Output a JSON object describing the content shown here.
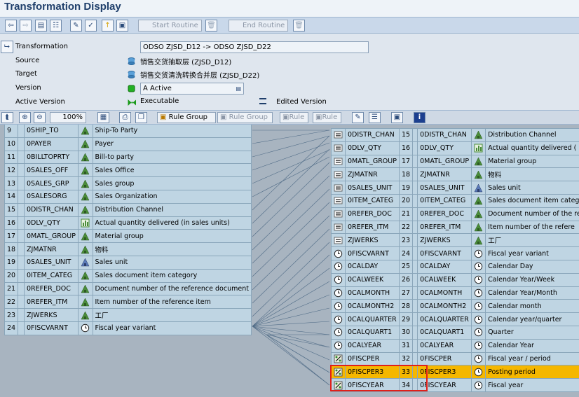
{
  "title": "Transformation Display",
  "app_toolbar": {
    "start_routine": "Start Routine",
    "end_routine": "End Routine"
  },
  "header": {
    "transformation_label": "Transformation",
    "transformation_value": "ODSO ZJSD_D12 -> ODSO ZJSD_D22",
    "source_label": "Source",
    "source_value": "销售交货抽取层 (ZJSD_D12)",
    "target_label": "Target",
    "target_value": "销售交货清洗转换合并层 (ZJSD_D22)",
    "version_label": "Version",
    "version_value": "A Active",
    "active_version_label": "Active Version",
    "active_version_value": "Executable",
    "edited_version_label": "Edited Version"
  },
  "canvas_toolbar": {
    "zoom": "100%",
    "rule_group": "Rule Group",
    "rule_group_disabled": "Rule Group",
    "rule": "Rule",
    "rule_disabled": "Rule"
  },
  "source_rows": [
    {
      "num": "9",
      "name": "0SHIP_TO",
      "icon": "characteristic-icon",
      "desc": "Ship-To Party"
    },
    {
      "num": "10",
      "name": "0PAYER",
      "icon": "characteristic-icon",
      "desc": "Payer"
    },
    {
      "num": "11",
      "name": "0BILLTOPRTY",
      "icon": "characteristic-icon",
      "desc": "Bill-to party"
    },
    {
      "num": "12",
      "name": "0SALES_OFF",
      "icon": "characteristic-icon",
      "desc": "Sales Office"
    },
    {
      "num": "13",
      "name": "0SALES_GRP",
      "icon": "characteristic-icon",
      "desc": "Sales group"
    },
    {
      "num": "14",
      "name": "0SALESORG",
      "icon": "characteristic-icon",
      "desc": "Sales Organization"
    },
    {
      "num": "15",
      "name": "0DISTR_CHAN",
      "icon": "characteristic-icon",
      "desc": "Distribution Channel"
    },
    {
      "num": "16",
      "name": "0DLV_QTY",
      "icon": "keyfigure-icon",
      "desc": "Actual quantity delivered (in sales units)"
    },
    {
      "num": "17",
      "name": "0MATL_GROUP",
      "icon": "characteristic-icon",
      "desc": "Material group"
    },
    {
      "num": "18",
      "name": "ZJMATNR",
      "icon": "characteristic-icon",
      "desc": "物料"
    },
    {
      "num": "19",
      "name": "0SALES_UNIT",
      "icon": "unit-icon",
      "desc": "Sales unit"
    },
    {
      "num": "20",
      "name": "0ITEM_CATEG",
      "icon": "characteristic-icon",
      "desc": "Sales document item category"
    },
    {
      "num": "21",
      "name": "0REFER_DOC",
      "icon": "characteristic-icon",
      "desc": "Document number of the reference document"
    },
    {
      "num": "22",
      "name": "0REFER_ITM",
      "icon": "characteristic-icon",
      "desc": "Item number of the reference item"
    },
    {
      "num": "23",
      "name": "ZJWERKS",
      "icon": "characteristic-icon",
      "desc": "工厂"
    },
    {
      "num": "24",
      "name": "0FISCVARNT",
      "icon": "time-icon",
      "desc": "Fiscal year variant"
    }
  ],
  "target_rows": [
    {
      "rule": "equals-icon",
      "src": "0DISTR_CHAN",
      "num": "15",
      "name": "0DISTR_CHAN",
      "icon": "characteristic-icon",
      "desc": "Distribution Channel"
    },
    {
      "rule": "equals-icon",
      "src": "0DLV_QTY",
      "num": "16",
      "name": "0DLV_QTY",
      "icon": "keyfigure-icon",
      "desc": "Actual quantity delivered ("
    },
    {
      "rule": "equals-icon",
      "src": "0MATL_GROUP",
      "num": "17",
      "name": "0MATL_GROUP",
      "icon": "characteristic-icon",
      "desc": "Material group"
    },
    {
      "rule": "equals-icon",
      "src": "ZJMATNR",
      "num": "18",
      "name": "ZJMATNR",
      "icon": "characteristic-icon",
      "desc": "物料"
    },
    {
      "rule": "equals-icon",
      "src": "0SALES_UNIT",
      "num": "19",
      "name": "0SALES_UNIT",
      "icon": "unit-icon",
      "desc": "Sales unit"
    },
    {
      "rule": "equals-icon",
      "src": "0ITEM_CATEG",
      "num": "20",
      "name": "0ITEM_CATEG",
      "icon": "characteristic-icon",
      "desc": "Sales document item categ"
    },
    {
      "rule": "equals-icon",
      "src": "0REFER_DOC",
      "num": "21",
      "name": "0REFER_DOC",
      "icon": "characteristic-icon",
      "desc": "Document number of the re"
    },
    {
      "rule": "equals-icon",
      "src": "0REFER_ITM",
      "num": "22",
      "name": "0REFER_ITM",
      "icon": "characteristic-icon",
      "desc": "Item number of the refere"
    },
    {
      "rule": "equals-icon",
      "src": "ZJWERKS",
      "num": "23",
      "name": "ZJWERKS",
      "icon": "characteristic-icon",
      "desc": "工厂"
    },
    {
      "rule": "time-rule-icon",
      "src": "0FISCVARNT",
      "num": "24",
      "name": "0FISCVARNT",
      "icon": "time-icon",
      "desc": "Fiscal year variant"
    },
    {
      "rule": "time-rule-icon",
      "src": "0CALDAY",
      "num": "25",
      "name": "0CALDAY",
      "icon": "time-icon",
      "desc": "Calendar Day"
    },
    {
      "rule": "time-rule-icon",
      "src": "0CALWEEK",
      "num": "26",
      "name": "0CALWEEK",
      "icon": "time-icon",
      "desc": "Calendar Year/Week"
    },
    {
      "rule": "time-rule-icon",
      "src": "0CALMONTH",
      "num": "27",
      "name": "0CALMONTH",
      "icon": "time-icon",
      "desc": "Calendar Year/Month"
    },
    {
      "rule": "time-rule-icon",
      "src": "0CALMONTH2",
      "num": "28",
      "name": "0CALMONTH2",
      "icon": "time-icon",
      "desc": "Calendar month"
    },
    {
      "rule": "time-rule-icon",
      "src": "0CALQUARTER",
      "num": "29",
      "name": "0CALQUARTER",
      "icon": "time-icon",
      "desc": "Calendar year/quarter"
    },
    {
      "rule": "time-rule-icon",
      "src": "0CALQUART1",
      "num": "30",
      "name": "0CALQUART1",
      "icon": "time-icon",
      "desc": "Quarter"
    },
    {
      "rule": "time-rule-icon",
      "src": "0CALYEAR",
      "num": "31",
      "name": "0CALYEAR",
      "icon": "time-icon",
      "desc": "Calendar Year"
    },
    {
      "rule": "routine-icon",
      "src": "0FISCPER",
      "num": "32",
      "name": "0FISCPER",
      "icon": "time-icon",
      "desc": "Fiscal year / period"
    },
    {
      "rule": "routine-icon",
      "src": "0FISCPER3",
      "num": "33",
      "name": "0FISCPER3",
      "icon": "time-icon",
      "desc": "Posting period"
    },
    {
      "rule": "routine-icon",
      "src": "0FISCYEAR",
      "num": "34",
      "name": "0FISCYEAR",
      "icon": "time-icon",
      "desc": "Fiscal year"
    }
  ],
  "highlight": {
    "row_color": "#f5b700",
    "box_color": "#e0201a"
  }
}
